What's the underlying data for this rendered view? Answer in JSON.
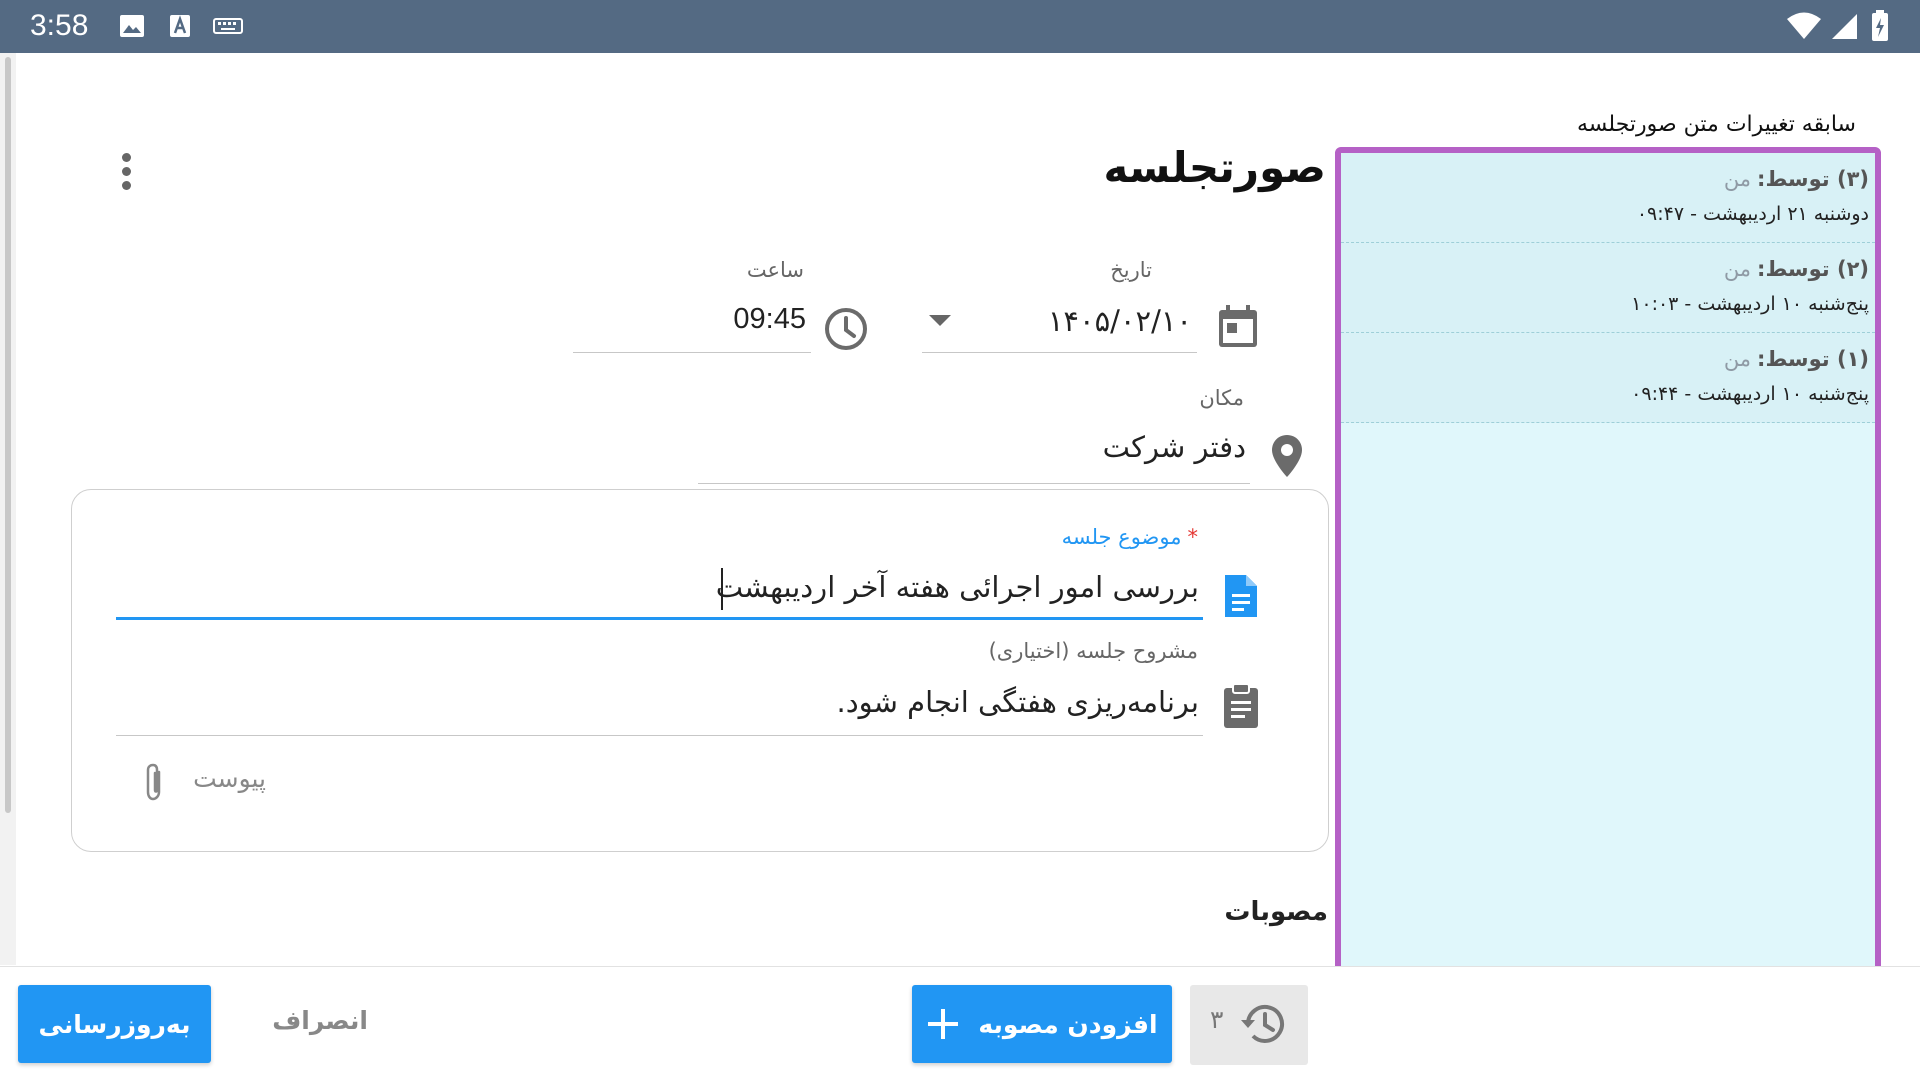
{
  "status_bar": {
    "time": "3:58"
  },
  "page": {
    "title": "صورتجلسه"
  },
  "form": {
    "date": {
      "label": "تاریخ",
      "value": "۱۴۰۵/۰۲/۱۰"
    },
    "time": {
      "label": "ساعت",
      "value": "09:45"
    },
    "location": {
      "label": "مکان",
      "value": "دفتر شرکت"
    },
    "subject": {
      "label": "موضوع جلسه",
      "required_mark": "*",
      "value": "بررسی امور اجرائی هفته آخر اردیبهشت"
    },
    "agenda": {
      "label": "مشروح جلسه (اختیاری)",
      "value": "برنامه‌ریزی هفتگی انجام شود."
    },
    "attachment_label": "پیوست"
  },
  "history": {
    "title": "سابقه تغییرات متن صورتجلسه",
    "items": [
      {
        "num": "(۳)",
        "by_label": "توسط:",
        "by": "من",
        "when": "دوشنبه ۲۱ اردیبهشت - ۰۹:۴۷"
      },
      {
        "num": "(۲)",
        "by_label": "توسط:",
        "by": "من",
        "when": "پنج‌شنبه ۱۰ اردیبهشت - ۱۰:۰۳"
      },
      {
        "num": "(۱)",
        "by_label": "توسط:",
        "by": "من",
        "when": "پنج‌شنبه ۱۰ اردیبهشت - ۰۹:۴۴"
      }
    ]
  },
  "resolutions": {
    "title": "مصوبات"
  },
  "actions": {
    "update_label": "به‌روزرسانی",
    "cancel_label": "انصراف",
    "add_resolution_label": "افزودن مصوبه",
    "history_count": "۳"
  },
  "colors": {
    "primary": "#2196f3",
    "status_bar": "#546a83",
    "history_border": "#b561c6",
    "history_bg": "#e0f7fb"
  }
}
